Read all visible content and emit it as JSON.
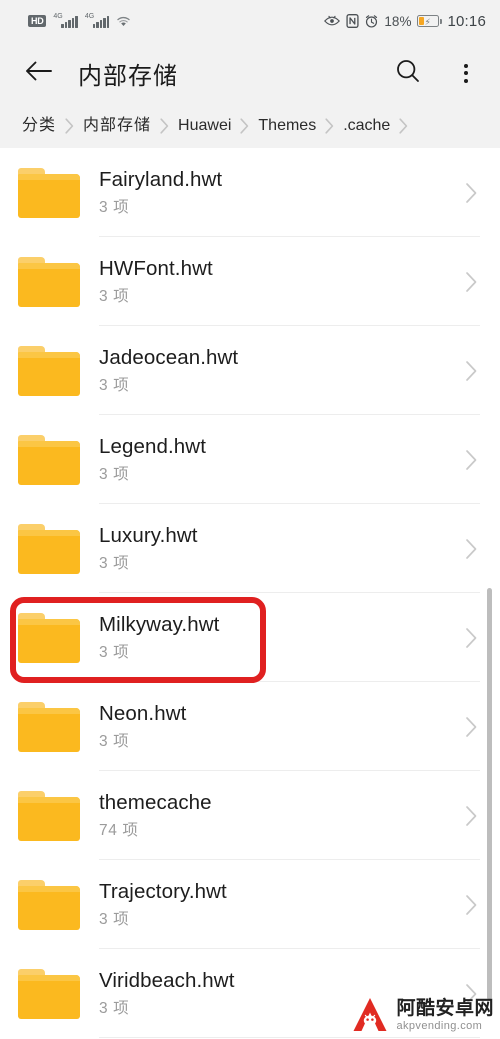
{
  "statusbar": {
    "hd_label": "HD",
    "sim1_network": "4G",
    "sim2_network": "4G",
    "wifi_icon": "wifi-icon",
    "eye_icon": "eye-comfort-icon",
    "nfc_icon": "nfc-icon",
    "alarm_icon": "alarm-icon",
    "battery_percent": "18%",
    "battery_icon": "battery-charging-icon",
    "clock": "10:16"
  },
  "appbar": {
    "back_icon": "back-arrow-icon",
    "title": "内部存储",
    "search_icon": "search-icon",
    "menu_icon": "more-vertical-icon"
  },
  "breadcrumb": {
    "separator_icon": "chevron-right-icon",
    "items": [
      {
        "label": "分类",
        "cn": true
      },
      {
        "label": "内部存储",
        "cn": true
      },
      {
        "label": "Huawei",
        "cn": false
      },
      {
        "label": "Themes",
        "cn": false
      },
      {
        "label": ".cache",
        "cn": false
      }
    ]
  },
  "list": {
    "folder_icon": "folder-icon",
    "chevron_icon": "chevron-right-icon",
    "rows": [
      {
        "title": "Fairyland.hwt",
        "sub": "3 项"
      },
      {
        "title": "HWFont.hwt",
        "sub": "3 项"
      },
      {
        "title": "Jadeocean.hwt",
        "sub": "3 项"
      },
      {
        "title": "Legend.hwt",
        "sub": "3 项"
      },
      {
        "title": "Luxury.hwt",
        "sub": "3 项"
      },
      {
        "title": "Milkyway.hwt",
        "sub": "3 项"
      },
      {
        "title": "Neon.hwt",
        "sub": "3 项"
      },
      {
        "title": "themecache",
        "sub": "74 项"
      },
      {
        "title": "Trajectory.hwt",
        "sub": "3 项"
      },
      {
        "title": "Viridbeach.hwt",
        "sub": "3 项"
      }
    ]
  },
  "annotation": {
    "highlight_color": "#e02020",
    "highlighted_row_title": "Milkyway.hwt"
  },
  "watermark": {
    "cn_text": "阿酷安卓网",
    "en_text": "akpvending.com",
    "logo_color": "#e1251b"
  }
}
